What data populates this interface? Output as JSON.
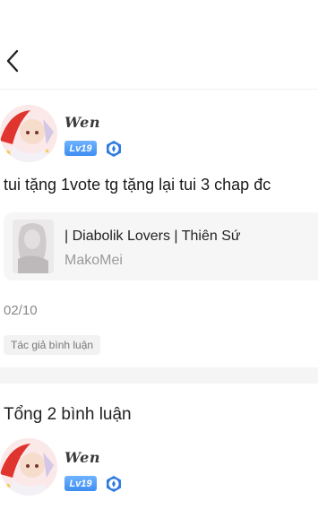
{
  "header": {
    "back_icon": "chevron-left-icon"
  },
  "post": {
    "username": "Wen",
    "level": "Lv19",
    "medal_icon": "medal-icon",
    "text": "tui tặng 1vote tg tặng lại tui 3 chap đc",
    "book": {
      "title": "| Diabolik Lovers | Thiên Sứ",
      "author": "MakoMei"
    },
    "date": "02/10",
    "author_tag": "Tác giả bình luận"
  },
  "comments": {
    "total_label": "Tổng 2 bình luận",
    "items": [
      {
        "username": "Wen",
        "level": "Lv19"
      }
    ]
  },
  "colors": {
    "level_badge": "#3d8df2",
    "medal": "#2f7be0",
    "card_bg": "#f6f6f6"
  }
}
